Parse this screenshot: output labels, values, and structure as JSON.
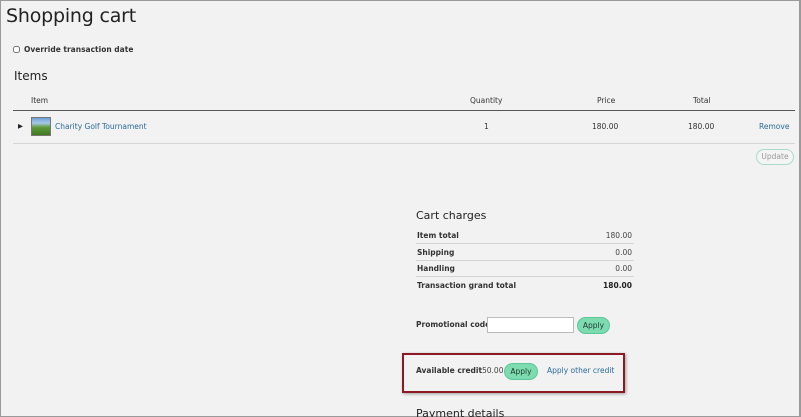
{
  "page": {
    "title": "Shopping cart"
  },
  "override": {
    "label": "Override transaction date",
    "checked": false
  },
  "items": {
    "heading": "Items",
    "columns": {
      "item": "Item",
      "quantity": "Quantity",
      "price": "Price",
      "total": "Total"
    },
    "rows": [
      {
        "name": "Charity Golf Tournament",
        "quantity": "1",
        "price": "180.00",
        "total": "180.00",
        "remove": "Remove",
        "thumbnail_icon": "golf-course-thumbnail"
      }
    ],
    "update_label": "Update"
  },
  "cart_charges": {
    "heading": "Cart charges",
    "rows": [
      {
        "label": "Item total",
        "value": "180.00"
      },
      {
        "label": "Shipping",
        "value": "0.00"
      },
      {
        "label": "Handling",
        "value": "0.00"
      },
      {
        "label": "Transaction grand total",
        "value": "180.00"
      }
    ]
  },
  "promo": {
    "label": "Promotional code",
    "value": "",
    "apply_label": "Apply"
  },
  "credit": {
    "label": "Available credit",
    "amount": "50.00",
    "apply_label": "Apply",
    "other_label": "Apply other credit"
  },
  "payment": {
    "heading": "Payment details"
  },
  "colors": {
    "accent_button": "#7ddbb0",
    "link": "#2a6b9a",
    "highlight_border": "#8b1a22"
  }
}
